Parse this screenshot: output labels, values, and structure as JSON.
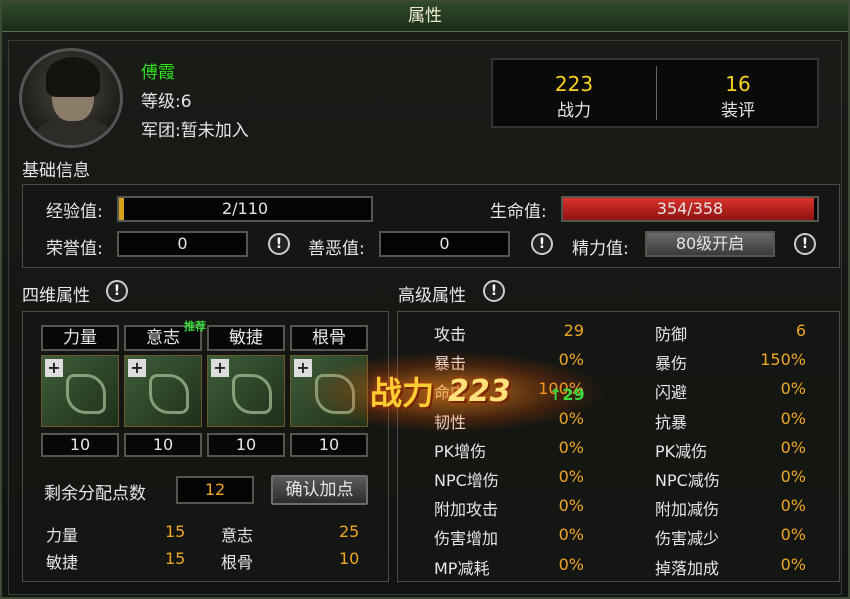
{
  "window_title": "属性",
  "character": {
    "name": "傅霞",
    "level": "等级:6",
    "guild": "军团:暂未加入"
  },
  "summary": {
    "combat_power_value": "223",
    "combat_power_label": "战力",
    "gear_score_value": "16",
    "gear_score_label": "装评"
  },
  "basic_info": {
    "title": "基础信息",
    "exp_label": "经验值:",
    "exp_value": "2/110",
    "exp_fraction": 0.018,
    "hp_label": "生命值:",
    "hp_value": "354/358",
    "hp_fraction": 0.989,
    "honor_label": "荣誉值:",
    "honor_value": "0",
    "karma_label": "善恶值:",
    "karma_value": "0",
    "energy_label": "精力值:",
    "energy_value": "80级开启"
  },
  "four_attr": {
    "title": "四维属性",
    "slots": [
      {
        "label": "力量",
        "value": "10"
      },
      {
        "label": "意志",
        "value": "10",
        "badge": "推荐"
      },
      {
        "label": "敏捷",
        "value": "10"
      },
      {
        "label": "根骨",
        "value": "10"
      }
    ],
    "remaining_label": "剩余分配点数",
    "remaining_value": "12",
    "confirm_button": "确认加点",
    "totals": [
      {
        "label": "力量",
        "value": "15"
      },
      {
        "label": "意志",
        "value": "25"
      },
      {
        "label": "敏捷",
        "value": "15"
      },
      {
        "label": "根骨",
        "value": "10"
      }
    ]
  },
  "advanced": {
    "title": "高级属性",
    "left": [
      {
        "label": "攻击",
        "value": "29"
      },
      {
        "label": "暴击",
        "value": "0%"
      },
      {
        "label": "命中",
        "value": "100%"
      },
      {
        "label": "韧性",
        "value": "0%"
      },
      {
        "label": "PK增伤",
        "value": "0%"
      },
      {
        "label": "NPC增伤",
        "value": "0%"
      },
      {
        "label": "附加攻击",
        "value": "0%"
      },
      {
        "label": "伤害增加",
        "value": "0%"
      },
      {
        "label": "MP减耗",
        "value": "0%"
      }
    ],
    "right": [
      {
        "label": "防御",
        "value": "6"
      },
      {
        "label": "暴伤",
        "value": "150%"
      },
      {
        "label": "闪避",
        "value": "0%"
      },
      {
        "label": "抗暴",
        "value": "0%"
      },
      {
        "label": "PK减伤",
        "value": "0%"
      },
      {
        "label": "NPC减伤",
        "value": "0%"
      },
      {
        "label": "附加减伤",
        "value": "0%"
      },
      {
        "label": "伤害减少",
        "value": "0%"
      },
      {
        "label": "掉落加成",
        "value": "0%"
      }
    ]
  },
  "popup": {
    "label": "战力",
    "value": "223",
    "delta": "29"
  }
}
